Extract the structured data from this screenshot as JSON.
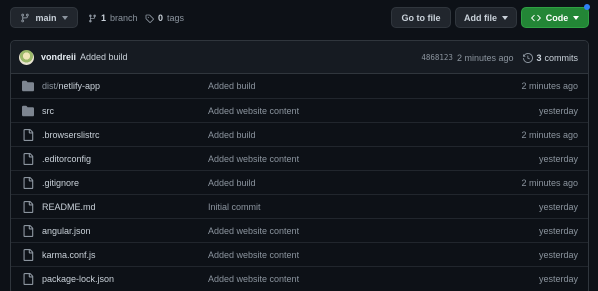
{
  "toolbar": {
    "branch_label": "main",
    "branches_count": "1",
    "branches_word": "branch",
    "tags_count": "0",
    "tags_word": "tags",
    "goto_file_label": "Go to file",
    "add_file_label": "Add file",
    "code_label": "Code"
  },
  "latest_commit": {
    "author": "vondreii",
    "message": "Added build",
    "sha": "4868123",
    "age": "2 minutes ago",
    "commits_count": "3",
    "commits_word": "commits"
  },
  "files": [
    {
      "type": "folder",
      "name_prefix": "dist/",
      "name": "netlify-app",
      "commit": "Added build",
      "age": "2 minutes ago"
    },
    {
      "type": "folder",
      "name_prefix": "",
      "name": "src",
      "commit": "Added website content",
      "age": "yesterday"
    },
    {
      "type": "file",
      "name_prefix": "",
      "name": ".browserslistrc",
      "commit": "Added build",
      "age": "2 minutes ago"
    },
    {
      "type": "file",
      "name_prefix": "",
      "name": ".editorconfig",
      "commit": "Added website content",
      "age": "yesterday"
    },
    {
      "type": "file",
      "name_prefix": "",
      "name": ".gitignore",
      "commit": "Added build",
      "age": "2 minutes ago"
    },
    {
      "type": "file",
      "name_prefix": "",
      "name": "README.md",
      "commit": "Initial commit",
      "age": "yesterday"
    },
    {
      "type": "file",
      "name_prefix": "",
      "name": "angular.json",
      "commit": "Added website content",
      "age": "yesterday"
    },
    {
      "type": "file",
      "name_prefix": "",
      "name": "karma.conf.js",
      "commit": "Added website content",
      "age": "yesterday"
    },
    {
      "type": "file",
      "name_prefix": "",
      "name": "package-lock.json",
      "commit": "Added website content",
      "age": "yesterday"
    }
  ],
  "colors": {
    "background": "#0d1117",
    "header_bg": "#161b22",
    "border": "#30363d",
    "code_button": "#238636",
    "folder_icon": "#7d8590",
    "notification_dot": "#2f81f7"
  },
  "icons": {
    "branch": "git-branch-icon",
    "tag": "tag-icon",
    "history": "history-icon",
    "folder": "folder-icon",
    "file": "file-icon",
    "code": "code-icon"
  }
}
